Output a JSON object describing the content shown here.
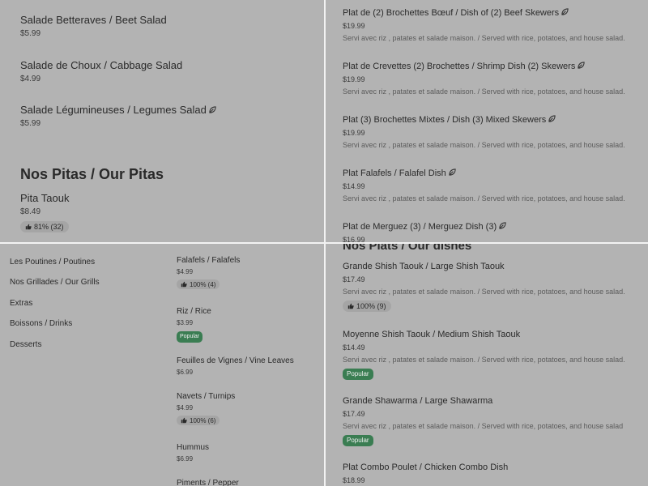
{
  "top_left": {
    "items": [
      {
        "name": "Salade Betteraves / Beet Salad",
        "price": "$5.99"
      },
      {
        "name": "Salade de Choux / Cabbage Salad",
        "price": "$4.99"
      },
      {
        "name": "Salade Légumineuses / Legumes Salad",
        "price": "$5.99",
        "icon": "leaf-icon"
      }
    ],
    "section_title": "Nos Pitas / Our Pitas",
    "pita": {
      "name": "Pita Taouk",
      "price": "$8.49",
      "rating": "81% (32)"
    }
  },
  "top_right": {
    "items": [
      {
        "name": "Plat de (2) Brochettes Bœuf / Dish of (2) Beef Skewers",
        "price": "$19.99",
        "desc": "Servi avec riz , patates et salade maison. / Served with rice, potatoes, and house salad."
      },
      {
        "name": "Plat de Crevettes (2) Brochettes / Shrimp Dish (2) Skewers",
        "price": "$19.99",
        "desc": "Servi avec riz , patates et salade maison. / Served with rice, potatoes, and house salad."
      },
      {
        "name": "Plat (3) Brochettes Mixtes / Dish (3) Mixed Skewers",
        "price": "$19.99",
        "desc": "Servi avec riz , patates et salade maison. / Served with rice, potatoes, and house salad."
      },
      {
        "name": "Plat Falafels / Falafel Dish",
        "price": "$14.99",
        "desc": "Servi avec riz , patates et salade maison. / Served with rice, potatoes, and house salad."
      },
      {
        "name": "Plat de Merguez (3) / Merguez Dish (3)",
        "price": "$16.99"
      }
    ]
  },
  "bottom_left": {
    "nav": [
      "Les Poutines / Poutines",
      "Nos Grillades / Our Grills",
      "Extras",
      "Boissons / Drinks",
      "Desserts"
    ],
    "items": [
      {
        "name": "Falafels / Falafels",
        "price": "$4.99",
        "rating": "100% (4)"
      },
      {
        "name": "Riz / Rice",
        "price": "$3.99",
        "badge": "Popular"
      },
      {
        "name": "Feuilles de Vignes / Vine Leaves",
        "price": "$6.99"
      },
      {
        "name": "Navets / Turnips",
        "price": "$4.99",
        "rating": "100% (6)"
      },
      {
        "name": "Hummus",
        "price": "$6.99"
      },
      {
        "name": "Piments / Pepper"
      }
    ]
  },
  "bottom_right": {
    "section_title": "Nos Plats / Our dishes",
    "items": [
      {
        "name": "Grande Shish Taouk / Large Shish Taouk",
        "price": "$17.49",
        "desc": "Servi avec riz , patates et salade maison. / Served with rice, potatoes, and house salad.",
        "rating": "100% (9)"
      },
      {
        "name": "Moyenne Shish Taouk / Medium Shish Taouk",
        "price": "$14.49",
        "desc": "Servi avec riz , patates et salade maison. / Served with rice, potatoes, and house salad.",
        "badge": "Popular"
      },
      {
        "name": "Grande Shawarma / Large Shawarma",
        "price": "$17.49",
        "desc": "Servi avec riz , patates et salade maison. / Served with rice, potatoes, and house salad",
        "badge": "Popular"
      },
      {
        "name": "Plat Combo Poulet / Chicken Combo Dish",
        "price": "$18.99"
      }
    ]
  },
  "colors": {
    "background": "#b3b3b3",
    "popular_badge": "#3a7d52",
    "divider": "#f2f2f2"
  }
}
